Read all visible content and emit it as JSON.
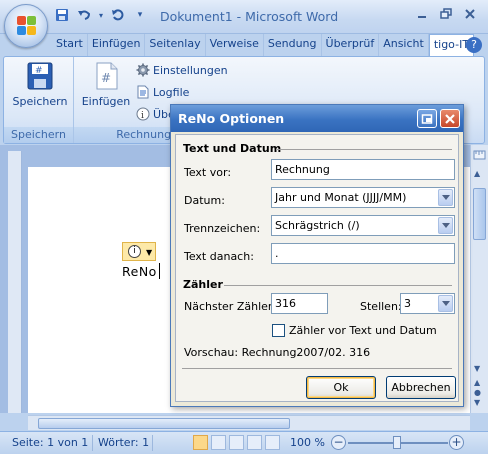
{
  "window": {
    "title": "Dokument1 - Microsoft Word",
    "qat_customize": "⇣"
  },
  "ribbon_tabs": [
    "Start",
    "Einfügen",
    "Seitenlay",
    "Verweise",
    "Sendung",
    "Überprüf",
    "Ansicht",
    "tigo-IT"
  ],
  "ribbon": {
    "group1": {
      "label": "Speichern",
      "button": "Speichern"
    },
    "group2": {
      "label": "Rechnungsn",
      "big_button": "Einfügen",
      "einstellungen": "Einstellungen",
      "logfile": "Logfile",
      "ueber": "Übe"
    }
  },
  "document": {
    "text": "ReNo"
  },
  "statusbar": {
    "page": "Seite: 1 von 1",
    "words": "Wörter: 1",
    "zoom": "100 %"
  },
  "dialog": {
    "title": "ReNo Optionen",
    "section1": "Text und Datum",
    "text_vor_label": "Text vor:",
    "text_vor_value": "Rechnung",
    "datum_label": "Datum:",
    "datum_value": "Jahr und Monat (JJJJ/MM)",
    "trennzeichen_label": "Trennzeichen:",
    "trennzeichen_value": "Schrägstrich (/)",
    "text_danach_label": "Text danach:",
    "text_danach_value": ".",
    "section2": "Zähler",
    "naechster_label": "Nächster Zähler:",
    "naechster_value": "316",
    "stellen_label": "Stellen:",
    "stellen_value": "3",
    "checkbox_label": "Zähler vor Text und Datum",
    "checkbox_checked": false,
    "preview": "Vorschau: Rechnung2007/02. 316",
    "ok": "Ok",
    "cancel": "Abbrechen"
  }
}
